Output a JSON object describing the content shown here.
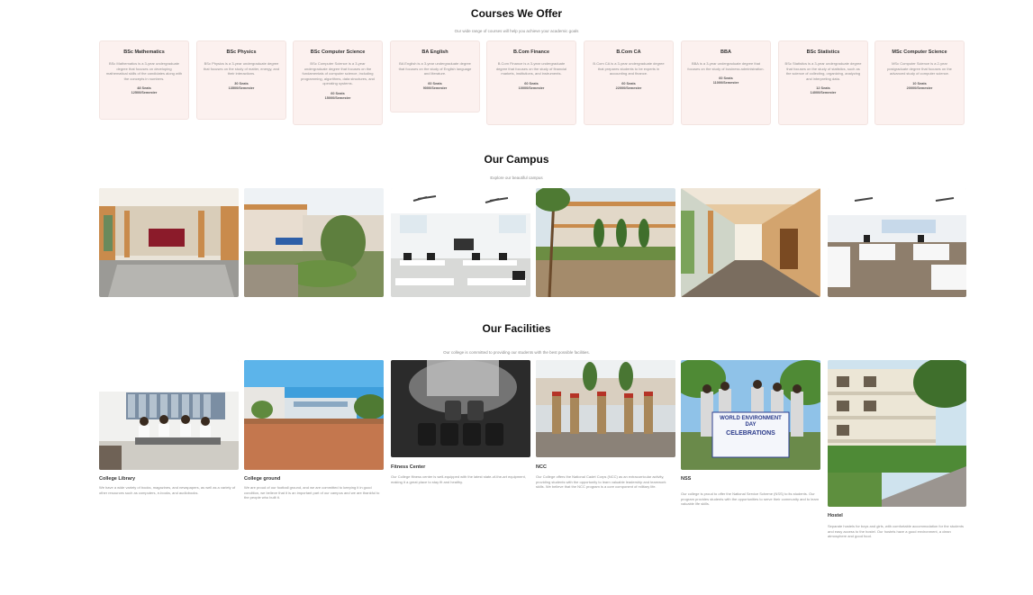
{
  "courses_section": {
    "title": "Courses We Offer",
    "subtitle": "Our wide range of courses will help you achieve your academic goals",
    "items": [
      {
        "name": "BSc Mathematics",
        "desc": "BSc Mathematics is a 3-year undergraduate degree that focuses on developing mathematical skills of the candidates along with the concepts in numbers.",
        "seats": "48 Seats",
        "fee": "12500/Semester"
      },
      {
        "name": "BSc Physics",
        "desc": "BSc Physics is a 3-year undergraduate degree that focuses on the study of matter, energy, and their interactions.",
        "seats": "30 Seats",
        "fee": "13500/Semester"
      },
      {
        "name": "BSc Computer Science",
        "desc": "BSc Computer Science is a 3-year undergraduate degree that focuses on the fundamentals of computer science, including programming, algorithms, data structures, and operating systems.",
        "seats": "60 Seats",
        "fee": "15000/Semester"
      },
      {
        "name": "BA English",
        "desc": "BA English is a 3-year undergraduate degree that focuses on the study of English language and literature.",
        "seats": "60 Seats",
        "fee": "9000/Semester"
      },
      {
        "name": "B.Com Finance",
        "desc": "B.Com Finance is a 3-year undergraduate degree that focuses on the study of financial markets, institutions, and instruments.",
        "seats": "60 Seats",
        "fee": "10000/Semester"
      },
      {
        "name": "B.Com CA",
        "desc": "B.Com CA is a 3-year undergraduate degree that prepares students to be experts in accounting and finance.",
        "seats": "60 Seats",
        "fee": "22000/Semester"
      },
      {
        "name": "BBA",
        "desc": "BBA is a 3-year undergraduate degree that focuses on the study of business administration.",
        "seats": "60 Seats",
        "fee": "11000/Semester"
      },
      {
        "name": "BSc Statistics",
        "desc": "BSc Statistics is a 3-year undergraduate degree that focuses on the study of statistics, such as the science of collecting, organizing, analyzing and interpreting data.",
        "seats": "12 Seats",
        "fee": "14000/Semester"
      },
      {
        "name": "MSc Computer Science",
        "desc": "MSc Computer Science is a 2-year postgraduate degree that focuses on the advanced study of computer science.",
        "seats": "10 Seats",
        "fee": "20000/Semester"
      }
    ]
  },
  "campus_section": {
    "title": "Our Campus",
    "subtitle": "Explore our beautiful campus"
  },
  "facilities_section": {
    "title": "Our Facilities",
    "subtitle": "Our college is committed to providing our students with the best possible facilities.",
    "items": [
      {
        "name": "College Library",
        "desc": "We have a wide variety of books, magazines, and newspapers, as well as a variety of other resources such as computers, e-books, and audiobooks."
      },
      {
        "name": "College ground",
        "desc": "We are proud of our football ground, and we are committed to keeping it in good condition, we believe that it is an important part of our campus and we are thankful to the people who built it."
      },
      {
        "name": "Fitness Center",
        "desc": "Our College fitness center is well-equipped with the latest state-of-the-art equipment, making it a great place to stay fit and healthy."
      },
      {
        "name": "NCC",
        "desc": "Our College offers the National Cadet Corps (NCC) as an extracurricular activity, providing students with the opportunity to learn valuable leadership and teamwork skills. We believe that the NCC program is a core component of military life."
      },
      {
        "name": "NSS",
        "desc": "Our college is proud to offer the National Service Scheme (NSS) to its students. Our program provides students with the opportunities to serve their community and to learn valuable life skills."
      },
      {
        "name": "Hostel",
        "desc": "Separate hostels for boys and girls, with comfortable accommodation for the students and easy access to the hostel. Our hostels have a good environment, a clean atmosphere and good food."
      }
    ]
  },
  "banner_text": {
    "line1": "WORLD ENVIRONMENT DAY",
    "line2": "CELEBRATIONS"
  }
}
